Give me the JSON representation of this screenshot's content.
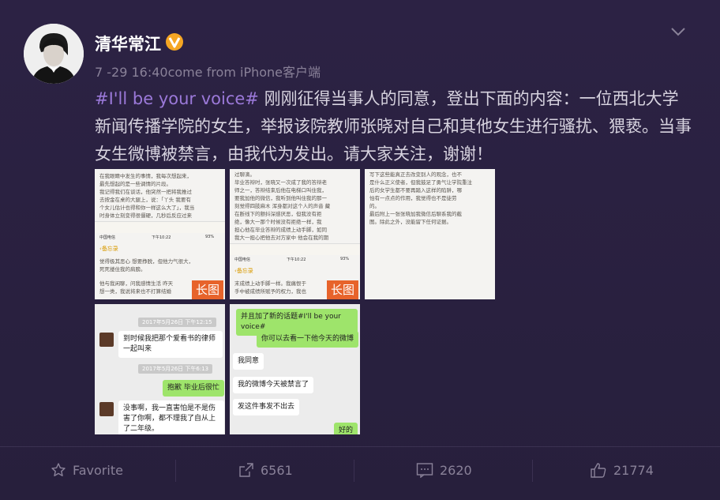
{
  "post": {
    "author": "清华常江",
    "timestamp": "7 -29 16:40",
    "source": "come from iPhone客户端",
    "hashtag": "#I'll be your voice#",
    "body_text": " 刚刚征得当事人的同意，登出下面的内容：一位西北大学新闻传播学院的女生，举报该院教师张晓对自己和其他女生进行骚扰、猥亵。当事女生微博被禁言，由我代为发出。请大家关注，谢谢！"
  },
  "images": {
    "long_label": "长图",
    "img1_lines": [
      "在我眼睛中发生的事情，我每次想起来，",
      "最先想起的是一些调情的片段。",
      "我记得我们在谈话，他突然一把将我推过",
      "去按金在桌的大腿上，说：「丫头 我要有",
      "个女儿估计也得和你一样这么大了」，我当",
      "时身体立刻变得很僵硬，几秒后反应过来"
    ],
    "img1_lower": [
      "觉得极其恶心 想要挣脱，但他力气很大，",
      "死死搂住我的肩膀。",
      "他与我闲聊，问我感情生活 昨天",
      "想一类，我说将来也不打算结婚"
    ],
    "img2_lines": [
      "过聊滴。",
      "毕业答辩时，张晓又一次成了我的答辩老",
      "师之一，答辩结束后他在电梯口叫住我，",
      "要我加他的微信，我听到他叫住我的那一",
      "刻觉得四肢麻木 浑身都对这个人的声音 藏",
      "在断线下的颤抖深感厌恶，但我没有拒",
      "绝，像大一那个时候没有拒绝一样，我",
      "担心他在毕业答辩的成绩上动手脚，如同",
      "我大一担心把他去对方家中 他会在我的期"
    ],
    "img2_lower": [
      "末成绩上动手脚一样。我痛恨于",
      "手中被成绩所赋予的权力，我也"
    ],
    "img3_lines": [
      "写下这些能真正去改变别人的观念，也不",
      "是什么正义使者，但我鼓足了勇气让学院重注",
      "后的女学生都不要再踏入这样的陷阱，哪",
      "怕有一点点的作用，我觉得也不是徒劳",
      "的。",
      "最后附上一张张晓加我微信后聊系我的截",
      "图。除此之外，没能留下任何证据。"
    ],
    "phone_carrier": "中国电信",
    "phone_time": "下午10:22",
    "phone_battery": "93%",
    "phone_back": "备忘录",
    "chat1": {
      "stamp1": "2017年5月26日 下午12:15",
      "msg1": "到时候我把那个爱看书的律师一起叫来",
      "stamp2": "2017年5月26日 下午6:13",
      "msg2": "抱歉 毕业后很忙",
      "msg3": "没事啊，我一直害怕是不是伤害了你啊，都不理我了自从上了二年级。"
    },
    "chat2": {
      "msg1": "并且加了新的话题#I'll be your voice#",
      "msg2": "你可以去看一下他今天的微博",
      "msg3": "我同意",
      "msg4": "我的微博今天被禁言了",
      "msg5": "发这件事发不出去",
      "msg6": "好的"
    }
  },
  "actions": {
    "favorite": "Favorite",
    "repost_count": "6561",
    "comment_count": "2620",
    "like_count": "21774"
  },
  "colors": {
    "background": "#2a2142",
    "hashtag": "#9b79d9",
    "long_badge": "#e7632b",
    "verified": "#f5a623"
  }
}
